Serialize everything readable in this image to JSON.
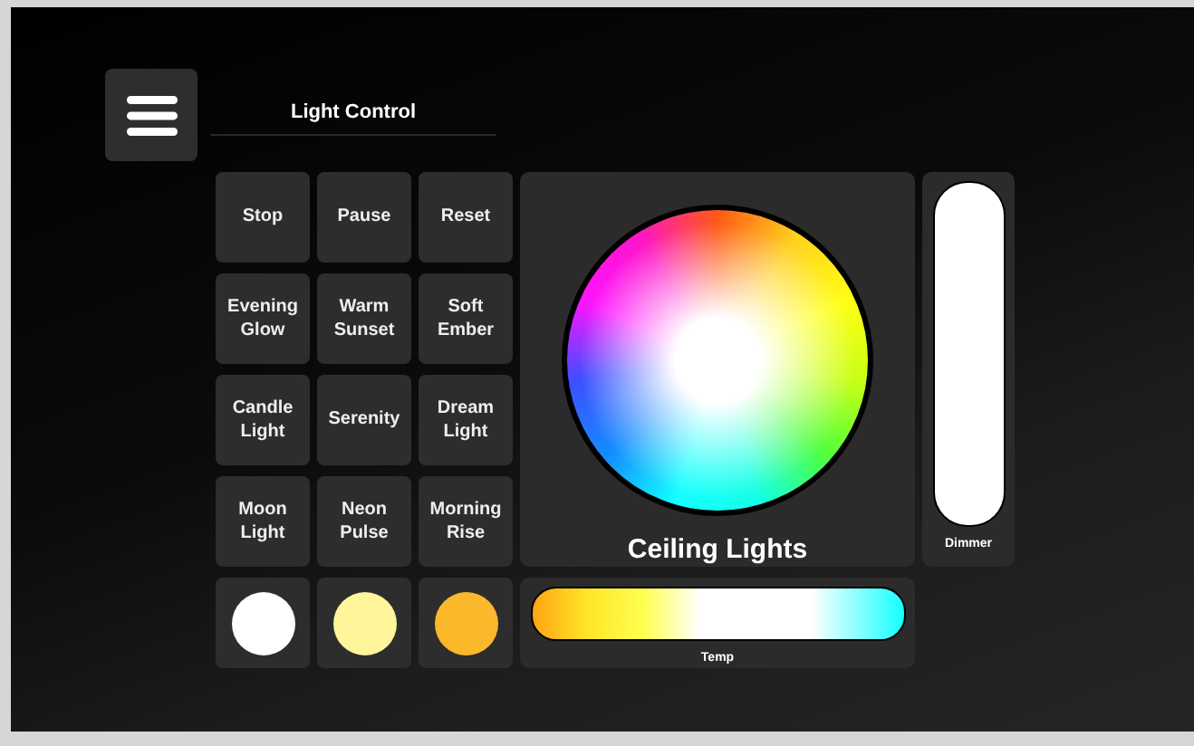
{
  "header": {
    "title": "Light Control"
  },
  "presets": [
    {
      "label": "Stop"
    },
    {
      "label": "Pause"
    },
    {
      "label": "Reset"
    },
    {
      "label": "Evening Glow"
    },
    {
      "label": "Warm Sunset"
    },
    {
      "label": "Soft Ember"
    },
    {
      "label": "Candle Light"
    },
    {
      "label": "Serenity"
    },
    {
      "label": "Dream Light"
    },
    {
      "label": "Moon Light"
    },
    {
      "label": "Neon Pulse"
    },
    {
      "label": "Morning Rise"
    }
  ],
  "swatches": [
    {
      "color": "#ffffff"
    },
    {
      "color": "#fff59a"
    },
    {
      "color": "#fbb82a"
    }
  ],
  "color_wheel": {
    "label": "Ceiling Lights"
  },
  "dimmer": {
    "label": "Dimmer",
    "level": 1
  },
  "temp": {
    "label": "Temp"
  }
}
